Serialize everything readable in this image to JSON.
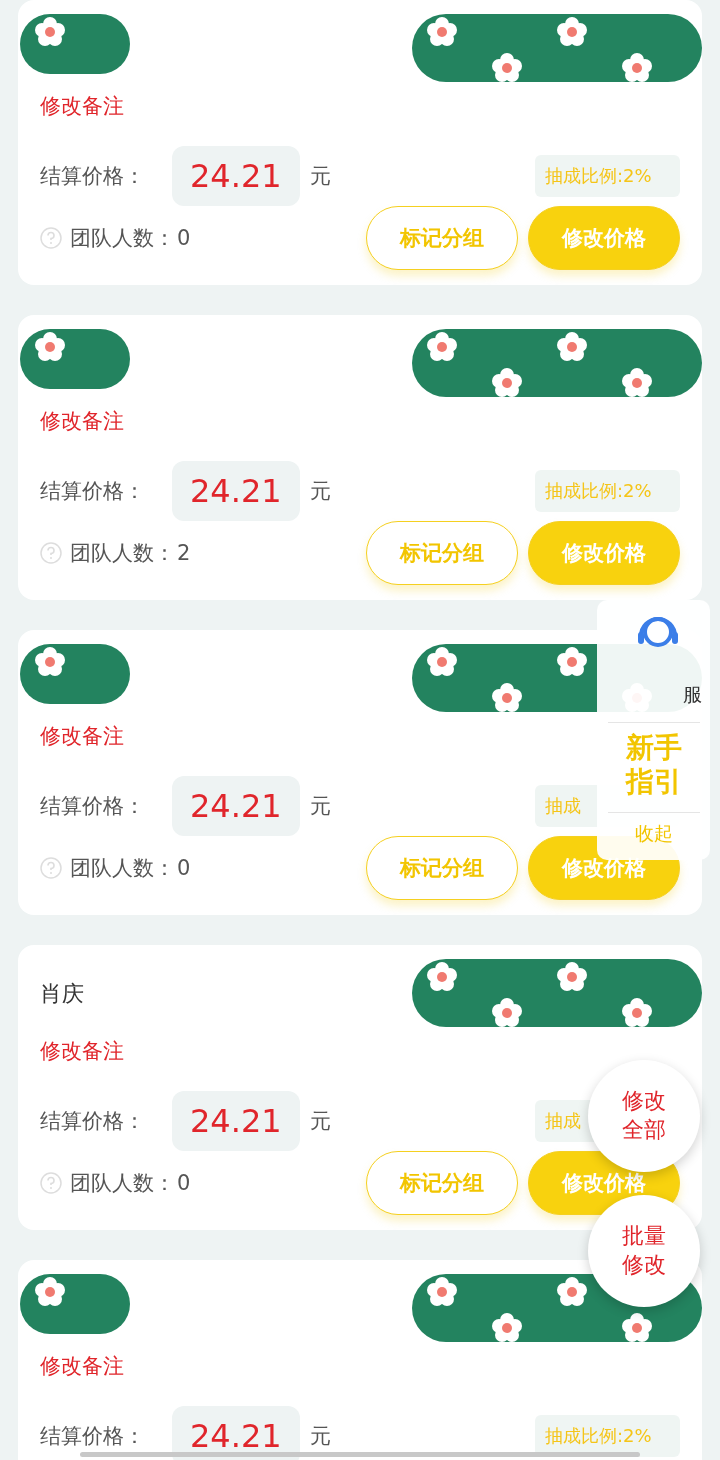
{
  "cards": [
    {
      "note_link": "修改备注",
      "price_label": "结算价格：",
      "price": "24.21",
      "unit": "元",
      "commission": "抽成比例:2%",
      "team_label": "团队人数：",
      "team_count": "0",
      "buttons": [
        {
          "label": "标记分组",
          "kind": "outline"
        },
        {
          "label": "修改价格",
          "kind": "filled"
        }
      ]
    },
    {
      "note_link": "修改备注",
      "price_label": "结算价格：",
      "price": "24.21",
      "unit": "元",
      "commission": "抽成比例:2%",
      "team_label": "团队人数：",
      "team_count": "2",
      "buttons": [
        {
          "label": "标记分组",
          "kind": "outline"
        },
        {
          "label": "修改价格",
          "kind": "filled"
        }
      ]
    },
    {
      "note_link": "修改备注",
      "price_label": "结算价格：",
      "price": "24.21",
      "unit": "元",
      "commission": "抽成",
      "team_label": "团队人数：",
      "team_count": "0",
      "buttons": [
        {
          "label": "标记分组",
          "kind": "outline"
        },
        {
          "label": "修改价格",
          "kind": "filled"
        }
      ]
    },
    {
      "name": "肖庆",
      "note_link": "修改备注",
      "price_label": "结算价格：",
      "price": "24.21",
      "unit": "元",
      "commission": "抽成",
      "team_label": "团队人数：",
      "team_count": "0",
      "buttons": [
        {
          "label": "标记分组",
          "kind": "outline"
        },
        {
          "label": "修改价格",
          "kind": "filled"
        }
      ]
    },
    {
      "note_link": "修改备注",
      "price_label": "结算价格：",
      "price": "24.21",
      "unit": "元",
      "commission": "抽成比例:2%"
    }
  ],
  "side_panel": {
    "service_label": "服",
    "guide": "新手指引",
    "collapse": "收起"
  },
  "round_buttons": [
    "修改全部",
    "批量修改"
  ]
}
